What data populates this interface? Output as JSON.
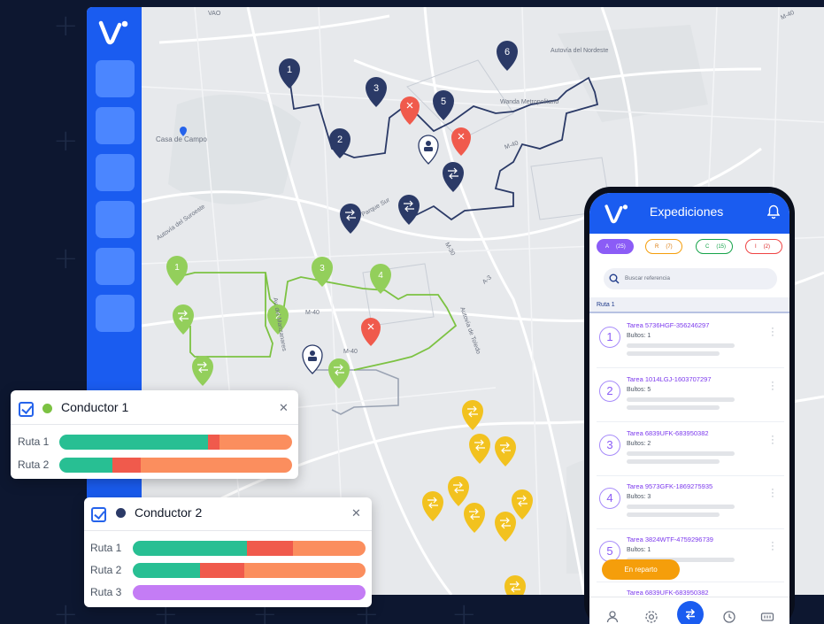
{
  "brand": {
    "accent": "#1a5cf0",
    "logo_icon": "vw-logo"
  },
  "map": {
    "labels": [
      "Casa de Campo",
      "Autovía del Nordeste",
      "Wanda Metropolitano",
      "M-40",
      "M-40",
      "Parque Sur",
      "M-30",
      "A-3",
      "Autovía de Toledo",
      "Autovía del Suroeste",
      "VAO",
      "Av. del Manzanares",
      "M-40",
      "M-40"
    ],
    "route_colors": {
      "route_navy": "#2b3a67",
      "route_green": "#7cc242",
      "stop_red": "#f05a4c",
      "stop_yellow": "#f2c21f"
    },
    "navy_stops": [
      "1",
      "2",
      "3",
      "5",
      "6"
    ],
    "green_stops": [
      "1",
      "2",
      "3",
      "4"
    ]
  },
  "conductor1": {
    "name": "Conductor 1",
    "dot_color": "#7cc242",
    "rows": [
      {
        "label": "Ruta 1",
        "segments": [
          0.64,
          0.05,
          0.31
        ]
      },
      {
        "label": "Ruta 2",
        "segments": [
          0.23,
          0.12,
          0.65
        ]
      }
    ]
  },
  "conductor2": {
    "name": "Conductor 2",
    "dot_color": "#2b3a67",
    "rows": [
      {
        "label": "Ruta 1",
        "segments": [
          0.49,
          0.2,
          0.31
        ]
      },
      {
        "label": "Ruta 2",
        "segments": [
          0.29,
          0.19,
          0.52
        ]
      },
      {
        "label": "Ruta 3",
        "segments": [
          1.0,
          0,
          0
        ]
      }
    ]
  },
  "bar_colors": {
    "done": "#28bf93",
    "failed": "#f05a4c",
    "pending": "#fb8e5e",
    "route3": "#c47cf5"
  },
  "phone": {
    "title": "Expediciones",
    "filters": [
      {
        "letter": "A",
        "count": "(25)"
      },
      {
        "letter": "R",
        "count": "(7)"
      },
      {
        "letter": "C",
        "count": "(15)"
      },
      {
        "letter": "I",
        "count": "(2)"
      }
    ],
    "search_placeholder": "Buscar referencia",
    "section": "Ruta 1",
    "tasks": [
      {
        "num": "1",
        "name": "Tarea 5736HGF-356246297",
        "bultos": "Bultos: 1"
      },
      {
        "num": "2",
        "name": "Tarea 1014LGJ-1603707297",
        "bultos": "Bultos: 5"
      },
      {
        "num": "3",
        "name": "Tarea 6839UFK-683950382",
        "bultos": "Bultos: 2"
      },
      {
        "num": "4",
        "name": "Tarea 9573GFK-1869275935",
        "bultos": "Bultos: 3"
      },
      {
        "num": "5",
        "name": "Tarea 3824WTF-4759296739",
        "bultos": "Bultos: 1"
      },
      {
        "num": "",
        "name": "Tarea 6839UFK-683950382",
        "bultos": ""
      }
    ],
    "badge": "En reparto",
    "tabs": [
      "user-icon",
      "settings-icon",
      "transfer-icon",
      "clock-icon",
      "truck-icon"
    ]
  }
}
